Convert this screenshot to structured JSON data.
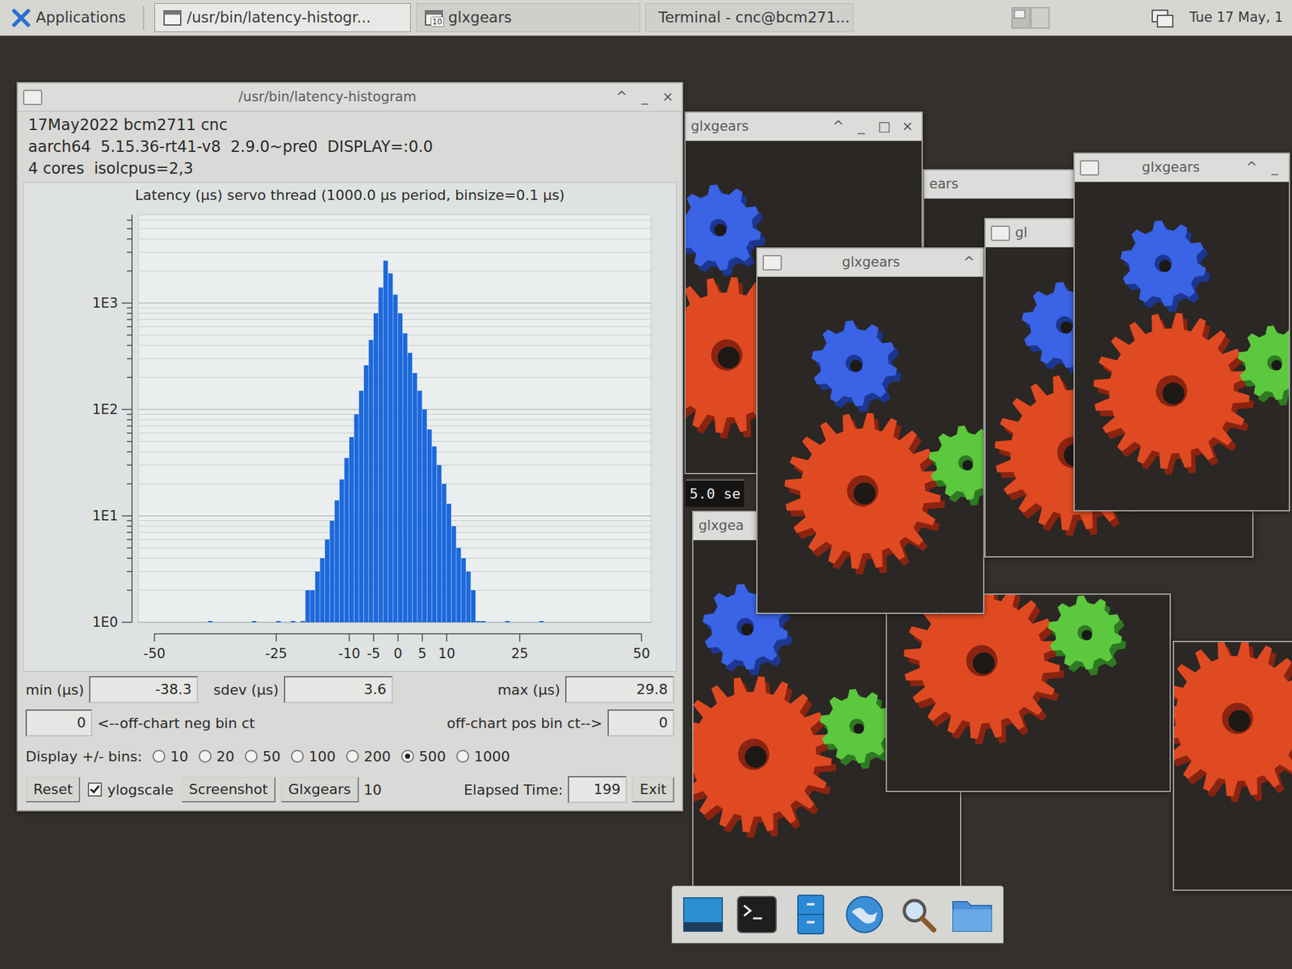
{
  "top_panel": {
    "applications": "Applications",
    "tasks": [
      {
        "label": "/usr/bin/latency-histogr...",
        "selected": true
      },
      {
        "label": "glxgears",
        "badge": "10",
        "selected": false
      },
      {
        "label": "Terminal - cnc@bcm271...",
        "selected": false
      }
    ],
    "clock": "Tue 17 May, 1"
  },
  "histogram_window": {
    "title": "/usr/bin/latency-histogram",
    "controls": [
      "^",
      "_",
      "×"
    ],
    "info_lines": [
      "17May2022 bcm2711 cnc",
      "aarch64  5.15.36-rt41-v8  2.9.0~pre0  DISPLAY=:0.0",
      "4 cores  isolcpus=2,3"
    ],
    "chart": {
      "title": "Latency (µs) servo thread (1000.0 µs period, binsize=0.1 µs)",
      "y_ticks": [
        {
          "label": "1E0",
          "value": 1
        },
        {
          "label": "1E1",
          "value": 10
        },
        {
          "label": "1E2",
          "value": 100
        },
        {
          "label": "1E3",
          "value": 1000
        }
      ],
      "x_ticks": [
        {
          "label": "-50",
          "value": -50
        },
        {
          "label": "-25",
          "value": -25
        },
        {
          "label": "-10",
          "value": -10
        },
        {
          "label": "-5",
          "value": -5
        },
        {
          "label": "0",
          "value": 0
        },
        {
          "label": "5",
          "value": 5
        },
        {
          "label": "10",
          "value": 10
        },
        {
          "label": "25",
          "value": 25
        },
        {
          "label": "50",
          "value": 50
        }
      ],
      "bins_from": -50,
      "bin_width": 1,
      "counts": [
        0,
        0,
        0,
        0,
        0,
        0,
        0,
        0,
        0,
        0,
        0,
        1,
        0,
        0,
        0,
        0,
        0,
        0,
        0,
        0,
        1,
        0,
        0,
        0,
        0,
        1,
        0,
        0,
        1,
        0,
        1,
        2,
        2,
        3,
        4,
        6,
        9,
        14,
        22,
        35,
        55,
        90,
        150,
        260,
        450,
        800,
        1400,
        2500,
        1900,
        1200,
        800,
        520,
        340,
        220,
        150,
        100,
        65,
        45,
        30,
        20,
        13,
        8,
        5,
        4,
        3,
        2,
        1,
        1,
        0,
        0,
        0,
        0,
        1,
        0,
        0,
        0,
        0,
        0,
        0,
        1,
        0,
        0,
        0,
        0,
        0,
        0,
        0,
        0,
        0,
        0,
        0,
        0,
        0,
        0,
        0,
        0,
        0,
        0,
        0,
        0
      ]
    },
    "min": {
      "label": "min (µs)",
      "value": "-38.3"
    },
    "sdev": {
      "label": "sdev (µs)",
      "value": "3.6"
    },
    "max": {
      "label": "max (µs)",
      "value": "29.8"
    },
    "neg_off_chart": {
      "label": "<--off-chart neg bin ct",
      "value": "0"
    },
    "pos_off_chart": {
      "label": "off-chart pos bin ct-->",
      "value": "0"
    },
    "display_bins": {
      "label": "Display +/- bins:",
      "options": [
        {
          "label": "10",
          "selected": false
        },
        {
          "label": "20",
          "selected": false
        },
        {
          "label": "50",
          "selected": false
        },
        {
          "label": "100",
          "selected": false
        },
        {
          "label": "200",
          "selected": false
        },
        {
          "label": "500",
          "selected": true
        },
        {
          "label": "1000",
          "selected": false
        }
      ]
    },
    "reset": "Reset",
    "ylogscale": {
      "label": "ylogscale",
      "checked": true
    },
    "screenshot": "Screenshot",
    "glxgears_button": "Glxgears",
    "glxgears_count": "10",
    "elapsed": {
      "label": "Elapsed Time:",
      "value": "199"
    },
    "exit": "Exit"
  },
  "gear_windows": [
    {
      "kind": "titled",
      "title": "glxgears",
      "controls": [
        "^",
        "_",
        "□",
        "×"
      ]
    },
    {
      "kind": "titled",
      "title": "ears",
      "controls": [
        "^",
        "_",
        "□"
      ]
    },
    {
      "kind": "titled",
      "title": "glxgea",
      "controls": []
    },
    {
      "kind": "covered"
    },
    {
      "kind": "covered"
    },
    {
      "kind": "titled",
      "title": "glxgears",
      "controls": [
        "^"
      ]
    },
    {
      "kind": "titled",
      "title": "gl",
      "controls": []
    },
    {
      "kind": "titled",
      "title": "glxgears",
      "controls": [
        "^",
        "_"
      ]
    }
  ],
  "terminal_fragment": "5.0 se"
}
